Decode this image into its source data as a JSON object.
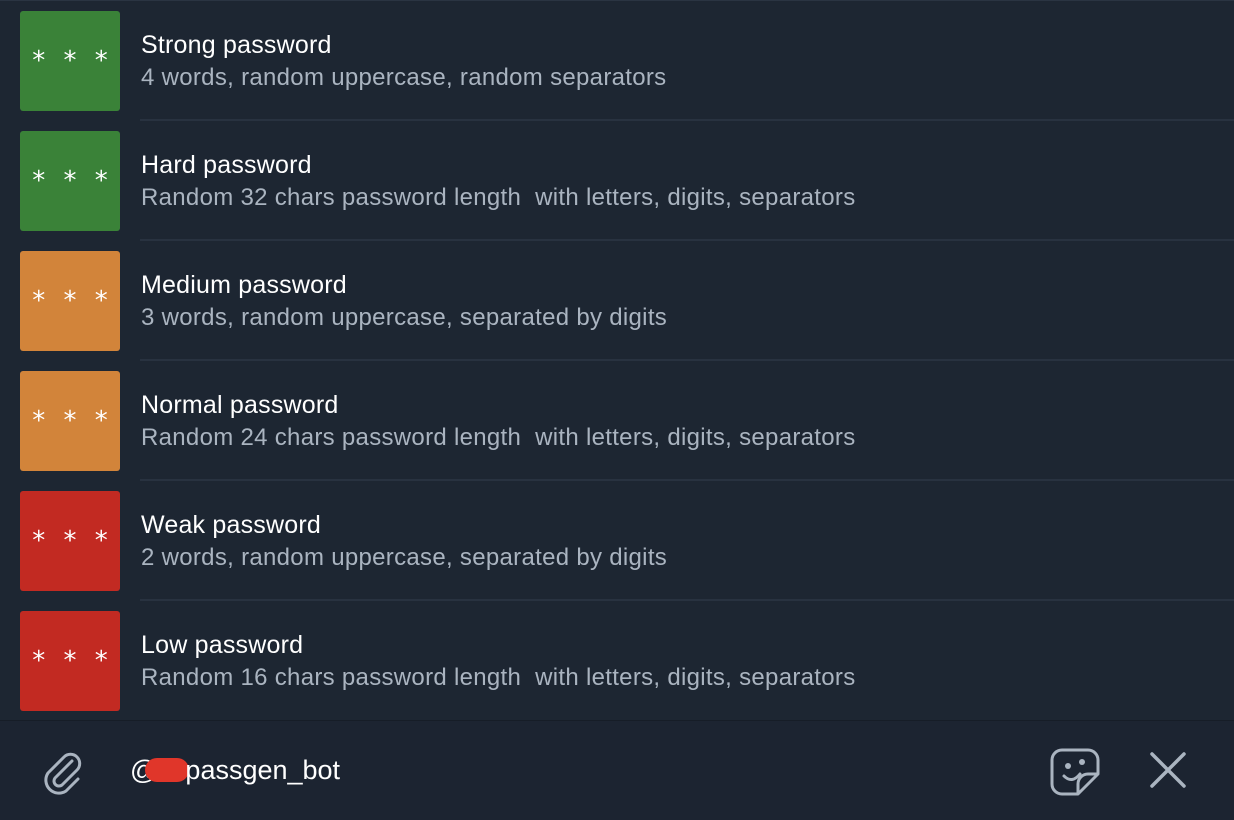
{
  "results": [
    {
      "title": "Strong password",
      "description": "4 words, random uppercase, random separators",
      "thumb_text": "* * *",
      "thumb_color": "#3a8238"
    },
    {
      "title": "Hard password",
      "description": "Random 32 chars password length  with letters, digits, separators",
      "thumb_text": "* * *",
      "thumb_color": "#3a8238"
    },
    {
      "title": "Medium password",
      "description": "3 words, random uppercase, separated by digits",
      "thumb_text": "* * *",
      "thumb_color": "#d2843a"
    },
    {
      "title": "Normal password",
      "description": "Random 24 chars password length  with letters, digits, separators",
      "thumb_text": "* * *",
      "thumb_color": "#d2843a"
    },
    {
      "title": "Weak password",
      "description": "2 words, random uppercase, separated by digits",
      "thumb_text": "* * *",
      "thumb_color": "#c22a22"
    },
    {
      "title": "Low password",
      "description": "Random 16 chars password length  with letters, digits, separators",
      "thumb_text": "* * *",
      "thumb_color": "#c22a22"
    }
  ],
  "composer": {
    "input_prefix": "@",
    "input_suffix": "passgen_bot",
    "icons": {
      "attach": "paperclip-icon",
      "sticker": "sticker-icon",
      "close": "close-icon"
    },
    "icon_color": "#aab4c0",
    "redaction_color": "#e0362a"
  },
  "colors": {
    "background": "#1d2632",
    "title_text": "#ffffff",
    "description_text": "#aab4c0"
  }
}
